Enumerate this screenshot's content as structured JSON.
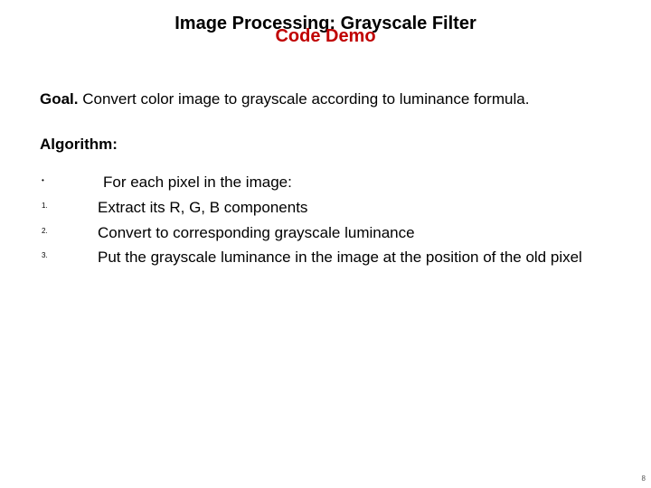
{
  "title": {
    "line1": "Image Processing:  Grayscale Filter",
    "line2": "Code Demo"
  },
  "goal": {
    "label": "Goal.",
    "text": "  Convert color image to grayscale according to luminance formula."
  },
  "algorithm_label": "Algorithm:",
  "steps": {
    "markers": [
      "•",
      "1.",
      "2.",
      "3."
    ],
    "lines": [
      " For each pixel in the image:",
      "Extract its R, G, B components",
      "Convert to corresponding grayscale luminance",
      "Put the grayscale luminance in the image at the position of the old pixel"
    ]
  },
  "page_number": "8"
}
